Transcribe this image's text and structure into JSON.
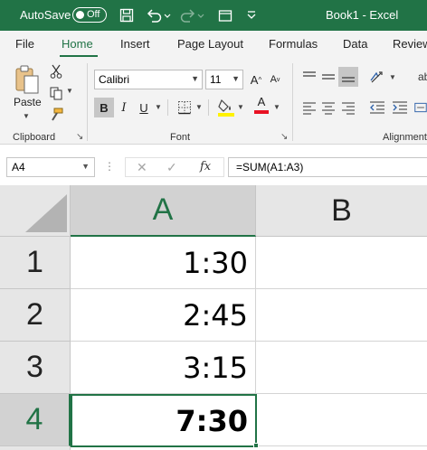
{
  "colors": {
    "accent": "#217346",
    "ribbon_bg": "#f3f3f3",
    "header_bg": "#e6e6e6",
    "font_color": "#e81123",
    "highlight_color": "#fff200"
  },
  "titlebar": {
    "autosave_label": "AutoSave",
    "toggle_text": "Off",
    "doc_title": "Book1  -  Excel"
  },
  "tabs": [
    {
      "label": "File"
    },
    {
      "label": "Home"
    },
    {
      "label": "Insert"
    },
    {
      "label": "Page Layout"
    },
    {
      "label": "Formulas"
    },
    {
      "label": "Data"
    },
    {
      "label": "Review"
    }
  ],
  "ribbon": {
    "paste_label": "Paste",
    "clipboard_label": "Clipboard",
    "font_label": "Font",
    "alignment_label": "Alignment",
    "font_name": "Calibri",
    "font_size": "11",
    "bold_label": "B",
    "italic_label": "I",
    "underline_label": "U",
    "font_color_glyph": "A",
    "grow_font_label": "A",
    "shrink_font_label": "A",
    "wrap_label": "ab"
  },
  "formula_bar": {
    "name_box": "A4",
    "fx_label": "fx",
    "formula": "=SUM(A1:A3)"
  },
  "grid": {
    "columns": [
      "A",
      "B"
    ],
    "rows": [
      {
        "num": "1",
        "a": "1:30",
        "b": ""
      },
      {
        "num": "2",
        "a": "2:45",
        "b": ""
      },
      {
        "num": "3",
        "a": "3:15",
        "b": ""
      },
      {
        "num": "4",
        "a": "7:30",
        "b": ""
      }
    ]
  }
}
